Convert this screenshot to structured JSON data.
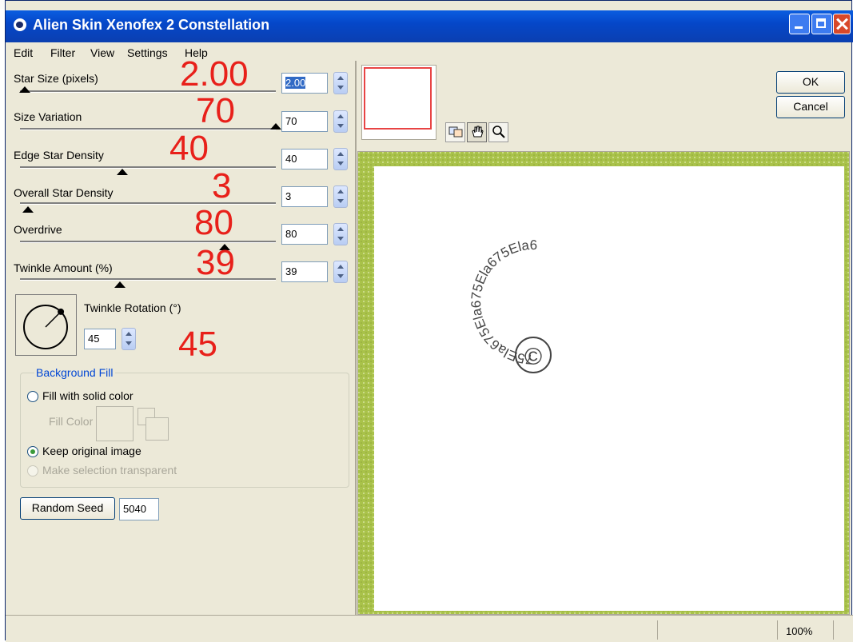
{
  "window": {
    "title": "Alien Skin Xenofex 2 Constellation"
  },
  "menu": [
    "Edit",
    "Filter",
    "View",
    "Settings",
    "Help"
  ],
  "sliders": [
    {
      "label": "Star Size (pixels)",
      "value": "2.00",
      "overlay": "2.00",
      "level": 0.02
    },
    {
      "label": "Size Variation",
      "value": "70",
      "overlay": "70",
      "level": 1.0
    },
    {
      "label": "Edge Star Density",
      "value": "40",
      "overlay": "40",
      "level": 0.4
    },
    {
      "label": "Overall Star Density",
      "value": "3",
      "overlay": "3",
      "level": 0.03
    },
    {
      "label": "Overdrive",
      "value": "80",
      "overlay": "80",
      "level": 0.8
    },
    {
      "label": "Twinkle Amount (%)",
      "value": "39",
      "overlay": "39",
      "level": 0.39
    }
  ],
  "rotation": {
    "label": "Twinkle Rotation (°)",
    "value": "45",
    "overlay": "45",
    "angle_deg": 45
  },
  "background_fill": {
    "group_label": "Background Fill",
    "options": [
      {
        "label": "Fill with solid color",
        "checked": false,
        "disabled": false
      },
      {
        "label": "Keep original image",
        "checked": true,
        "disabled": false
      },
      {
        "label": "Make selection transparent",
        "checked": false,
        "disabled": true
      }
    ],
    "fill_color_label": "Fill Color"
  },
  "random_seed": {
    "button_label": "Random Seed",
    "value": "5040"
  },
  "buttons": {
    "ok": "OK",
    "cancel": "Cancel"
  },
  "preview": {
    "ring_text": "75Ela675Ela675Ela675Ela6",
    "center_symbol": "©",
    "border_color": "#a9c24a"
  },
  "status": {
    "zoom": "100%"
  },
  "colors": {
    "title_bar": "#0a5de0",
    "overlay_numbers": "#e8201a",
    "group_title": "#0046d5"
  }
}
